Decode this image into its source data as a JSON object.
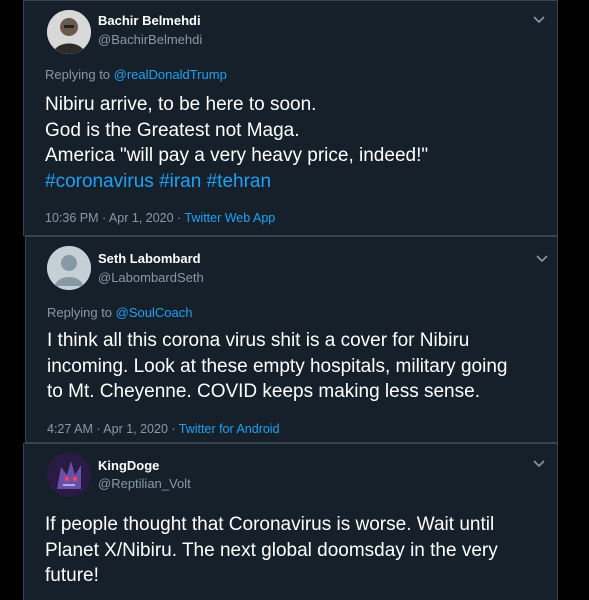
{
  "tweets": [
    {
      "name": "Bachir Belmehdi",
      "handle": "@BachirBelmehdi",
      "replying_prefix": "Replying to ",
      "replying_to": "@realDonaldTrump",
      "lines": [
        "Nibiru arrive, to be here to soon.",
        "God is the Greatest not Maga.",
        "America \"will pay a very  heavy price, indeed!\""
      ],
      "hashtags": [
        "#coronavirus",
        "#iran",
        "#tehran"
      ],
      "timestamp": "10:36 PM · Apr 1, 2020 · ",
      "app": "Twitter Web App"
    },
    {
      "name": "Seth Labombard",
      "handle": "@LabombardSeth",
      "replying_prefix": "Replying to ",
      "replying_to": "@SoulCoach",
      "lines": [
        "I think all this corona virus shit is a cover for Nibiru",
        "incoming. Look at these empty hospitals, military going",
        "to Mt. Cheyenne. COVID keeps making less sense."
      ],
      "timestamp": "4:27 AM · Apr 1, 2020 · ",
      "app": "Twitter for Android"
    },
    {
      "name": "KingDoge",
      "handle": "@Reptilian_Volt",
      "lines": [
        "If people thought that Coronavirus is worse. Wait until",
        "Planet X/Nibiru. The next global doomsday in the very",
        "future!"
      ]
    }
  ],
  "icons": {
    "chevron": "chevron-down-icon",
    "avatar_1": "person-photo",
    "avatar_2": "default-silhouette",
    "avatar_3": "dragon-illustration"
  },
  "colors": {
    "background": "#15202b",
    "border": "#38444d",
    "text": "#ffffff",
    "muted": "#8899a6",
    "accent": "#1da1f2"
  }
}
